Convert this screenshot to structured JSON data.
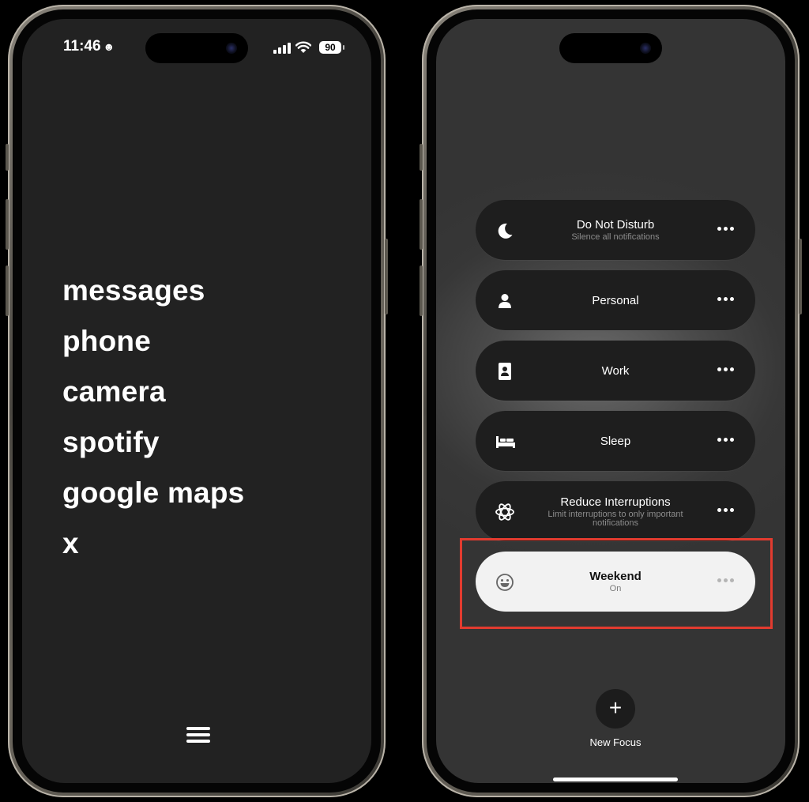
{
  "left_phone": {
    "status": {
      "time": "11:46",
      "battery": "90"
    },
    "apps": [
      "messages",
      "phone",
      "camera",
      "spotify",
      "google maps",
      "x"
    ]
  },
  "right_phone": {
    "focus_modes": [
      {
        "title": "Do Not Disturb",
        "subtitle": "Silence all notifications",
        "icon": "moon-icon"
      },
      {
        "title": "Personal",
        "subtitle": "",
        "icon": "person-icon"
      },
      {
        "title": "Work",
        "subtitle": "",
        "icon": "id-badge-icon"
      },
      {
        "title": "Sleep",
        "subtitle": "",
        "icon": "bed-icon"
      },
      {
        "title": "Reduce Interruptions",
        "subtitle": "Limit interruptions to only important notifications",
        "icon": "atom-icon"
      },
      {
        "title": "Weekend",
        "subtitle": "On",
        "icon": "smiley-icon",
        "active": true
      }
    ],
    "new_focus_label": "New Focus"
  },
  "colors": {
    "highlight": "#e23b2f",
    "left_screen": "#222222",
    "active_row": "#f2f2f2"
  }
}
